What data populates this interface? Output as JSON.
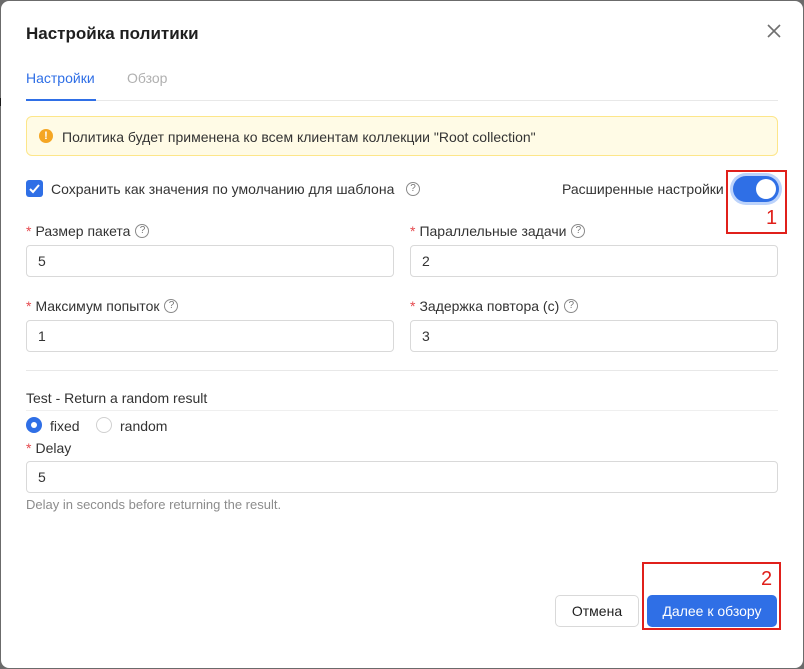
{
  "dialog": {
    "title": "Настройка политики",
    "tabs": [
      {
        "label": "Настройки",
        "active": true
      },
      {
        "label": "Обзор",
        "active": false
      }
    ],
    "alert": {
      "text": "Политика будет применена ко всем клиентам коллекции \"Root collection\""
    },
    "save_default": {
      "label": "Сохранить как значения по умолчанию для шаблона",
      "checked": true
    },
    "advanced": {
      "label": "Расширенные настройки",
      "enabled": true
    },
    "fields": {
      "batch_size": {
        "label": "Размер пакета",
        "value": "5"
      },
      "parallel_tasks": {
        "label": "Параллельные задачи",
        "value": "2"
      },
      "max_attempts": {
        "label": "Максимум попыток",
        "value": "1"
      },
      "retry_delay": {
        "label": "Задержка повтора (с)",
        "value": "3"
      }
    },
    "test_section": {
      "title": "Test - Return a random result",
      "options": [
        {
          "label": "fixed",
          "selected": true
        },
        {
          "label": "random",
          "selected": false
        }
      ],
      "delay": {
        "label": "Delay",
        "value": "5",
        "hint": "Delay in seconds before returning the result."
      }
    },
    "buttons": {
      "cancel": "Отмена",
      "next": "Далее к обзору"
    }
  },
  "annotations": [
    "1",
    "2"
  ],
  "colors": {
    "primary": "#2f6fe6",
    "required": "#e5484d",
    "annotation": "#e0201b",
    "alert_bg": "#fffbe6",
    "alert_icon": "#f5a623"
  }
}
